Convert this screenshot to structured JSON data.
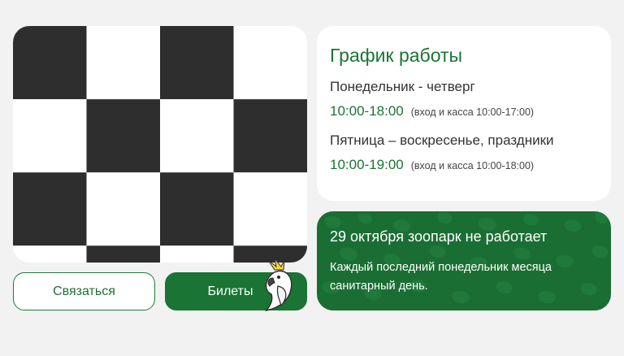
{
  "image": {
    "pattern": "checkerboard",
    "dark_color": "#2e2e2e",
    "light_color": "#ffffff"
  },
  "buttons": {
    "contact_label": "Связаться",
    "tickets_label": "Билеты",
    "mascot_icon": "cockatoo-icon"
  },
  "schedule": {
    "title": "График работы",
    "periods": [
      {
        "days": "Понедельник - четверг",
        "hours": "10:00-18:00",
        "note": "(вход и касса 10:00-17:00)"
      },
      {
        "days": "Пятница – воскресенье, праздники",
        "hours": "10:00-19:00",
        "note": "(вход и касса 10:00-18:00)"
      }
    ]
  },
  "notice": {
    "title": "29 октября зоопарк не работает",
    "description": "Каждый последний понедельник месяца санитарный день."
  },
  "colors": {
    "accent": "#1a7534",
    "background": "#f2f2f2"
  }
}
